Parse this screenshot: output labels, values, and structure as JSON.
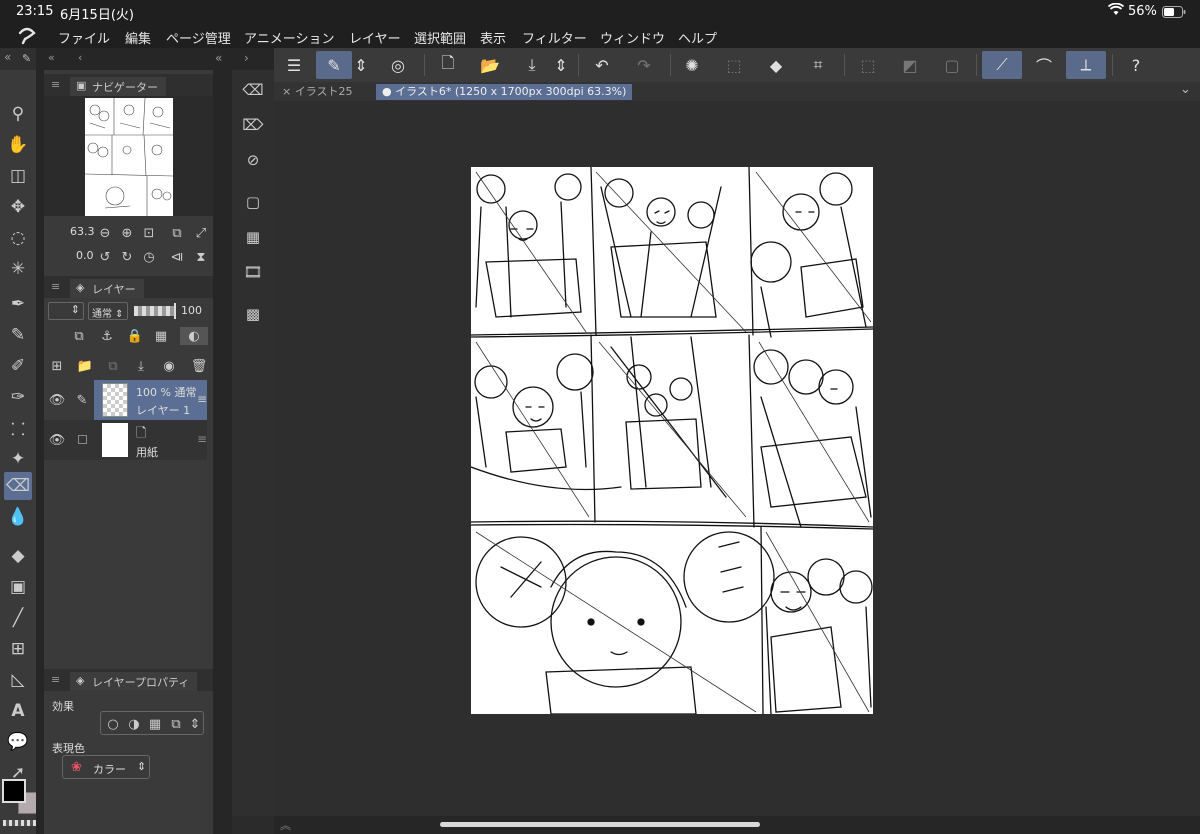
{
  "status": {
    "time": "23:15",
    "date": "6月15日(火)",
    "battery": "56%"
  },
  "menu": {
    "items": [
      "ファイル",
      "編集",
      "ページ管理",
      "アニメーション",
      "レイヤー",
      "選択範囲",
      "表示",
      "フィルター",
      "ウィンドウ",
      "ヘルプ"
    ]
  },
  "tabs": [
    {
      "label": "× イラスト25"
    },
    {
      "label": "● イラスト6* (1250 x 1700px 300dpi 63.3%)"
    }
  ],
  "navigator": {
    "title": "ナビゲーター",
    "zoom": "63.3",
    "rotation": "0.0"
  },
  "layers_panel": {
    "title": "レイヤー",
    "blend_mode": "通常",
    "opacity": "100",
    "layers": [
      {
        "opacity_mode": "100 % 通常",
        "name": "レイヤー 1"
      },
      {
        "name": "用紙"
      }
    ]
  },
  "layer_property": {
    "title": "レイヤープロパティ",
    "effect_label": "効果",
    "color_label": "表現色",
    "color_value": "カラー"
  },
  "colors": {
    "accent": "#5b6e93",
    "main_color": "#000000",
    "sub_color": "#b4a9ac"
  },
  "icons": {
    "app_logo": "csp-logo-icon",
    "wifi": "wifi-icon",
    "battery": "battery-icon"
  }
}
